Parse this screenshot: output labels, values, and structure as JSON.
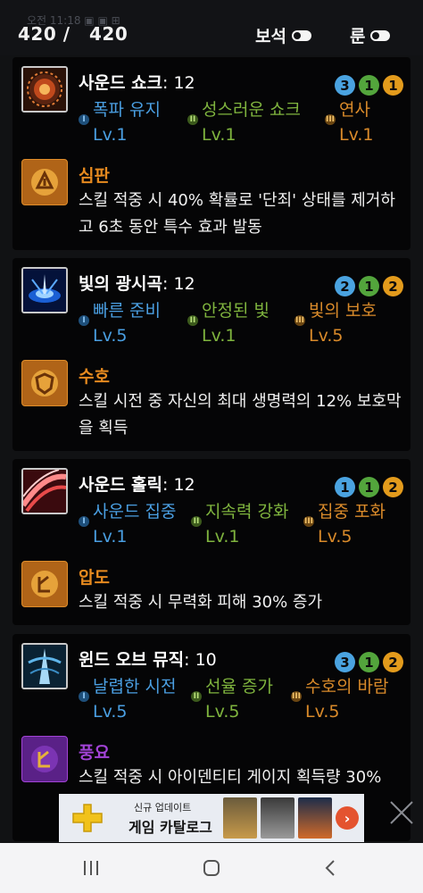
{
  "status_bar": {
    "ghost_text": "오전 11:18 ▣ ▣ ⊞"
  },
  "header": {
    "counter_current": "420 /",
    "counter_total": "420",
    "toggle_gem_label": "보석",
    "toggle_rune_label": "룬",
    "toggle_gem_on": true,
    "toggle_rune_on": true
  },
  "skills": [
    {
      "name": "사운드 쇼크",
      "level_text": ": 12",
      "icon": "sound-shock-icon",
      "gems": [
        {
          "value": "3",
          "color": "#4aa3e0"
        },
        {
          "value": "1",
          "color": "#53a53c"
        },
        {
          "value": "1",
          "color": "#e39b1c"
        }
      ],
      "tripods": [
        {
          "name": "폭파 유지",
          "level": "Lv.1",
          "color": "#4a9fe2",
          "tier": "I"
        },
        {
          "name": "성스러운 쇼크",
          "level": "Lv.1",
          "color": "#7fb43e",
          "tier": "II"
        },
        {
          "name": "연사",
          "level": "Lv.1",
          "color": "#d98a2a",
          "tier": "III"
        }
      ],
      "rune": {
        "name": "심판",
        "color": "#e68a1f",
        "desc": "스킬 적중 시 40% 확률로 '단죄' 상태를 제거하고 6초 동안 특수 효과 발동",
        "icon": "judgment-rune-icon"
      }
    },
    {
      "name": "빛의 광시곡",
      "level_text": ": 12",
      "icon": "light-rhapsody-icon",
      "gems": [
        {
          "value": "2",
          "color": "#4aa3e0"
        },
        {
          "value": "1",
          "color": "#53a53c"
        },
        {
          "value": "2",
          "color": "#e39b1c"
        }
      ],
      "tripods": [
        {
          "name": "빠른 준비",
          "level": "Lv.5",
          "color": "#4a9fe2",
          "tier": "I"
        },
        {
          "name": "안정된 빛",
          "level": "Lv.1",
          "color": "#7fb43e",
          "tier": "II"
        },
        {
          "name": "빛의 보호",
          "level": "Lv.5",
          "color": "#d98a2a",
          "tier": "III"
        }
      ],
      "rune": {
        "name": "수호",
        "color": "#e68a1f",
        "desc": "스킬 시전 중 자신의 최대 생명력의 12% 보호막을 획득",
        "icon": "guardian-rune-icon"
      }
    },
    {
      "name": "사운드 홀릭",
      "level_text": ": 12",
      "icon": "sound-holic-icon",
      "gems": [
        {
          "value": "1",
          "color": "#4aa3e0"
        },
        {
          "value": "1",
          "color": "#53a53c"
        },
        {
          "value": "2",
          "color": "#e39b1c"
        }
      ],
      "tripods": [
        {
          "name": "사운드 집중",
          "level": "Lv.1",
          "color": "#4a9fe2",
          "tier": "I"
        },
        {
          "name": "지속력 강화",
          "level": "Lv.1",
          "color": "#7fb43e",
          "tier": "II"
        },
        {
          "name": "집중 포화",
          "level": "Lv.5",
          "color": "#d98a2a",
          "tier": "III"
        }
      ],
      "rune": {
        "name": "압도",
        "color": "#e68a1f",
        "desc": "스킬 적중 시 무력화 피해 30% 증가",
        "icon": "overwhelm-rune-icon"
      }
    },
    {
      "name": "윈드 오브 뮤직",
      "level_text": ": 10",
      "icon": "wind-of-music-icon",
      "gems": [
        {
          "value": "3",
          "color": "#4aa3e0"
        },
        {
          "value": "1",
          "color": "#53a53c"
        },
        {
          "value": "2",
          "color": "#e39b1c"
        }
      ],
      "tripods": [
        {
          "name": "날렵한 시전",
          "level": "Lv.5",
          "color": "#4a9fe2",
          "tier": "I"
        },
        {
          "name": "선율 증가",
          "level": "Lv.5",
          "color": "#7fb43e",
          "tier": "II"
        },
        {
          "name": "수호의 바람",
          "level": "Lv.5",
          "color": "#d98a2a",
          "tier": "III"
        }
      ],
      "rune": {
        "name": "풍요",
        "color": "#a243d6",
        "desc": "스킬 적중 시 아이덴티티 게이지 획득량 30%",
        "icon": "abundance-rune-icon"
      }
    }
  ],
  "ad": {
    "subtitle": "신규 업데이트",
    "title": "게임 카탈로그",
    "icon": "playstation-plus-icon",
    "close_icon": "close-icon",
    "arrow": "›"
  },
  "navbar": {
    "recents_icon": "recents-icon",
    "home_icon": "home-icon",
    "back_icon": "back-icon"
  }
}
